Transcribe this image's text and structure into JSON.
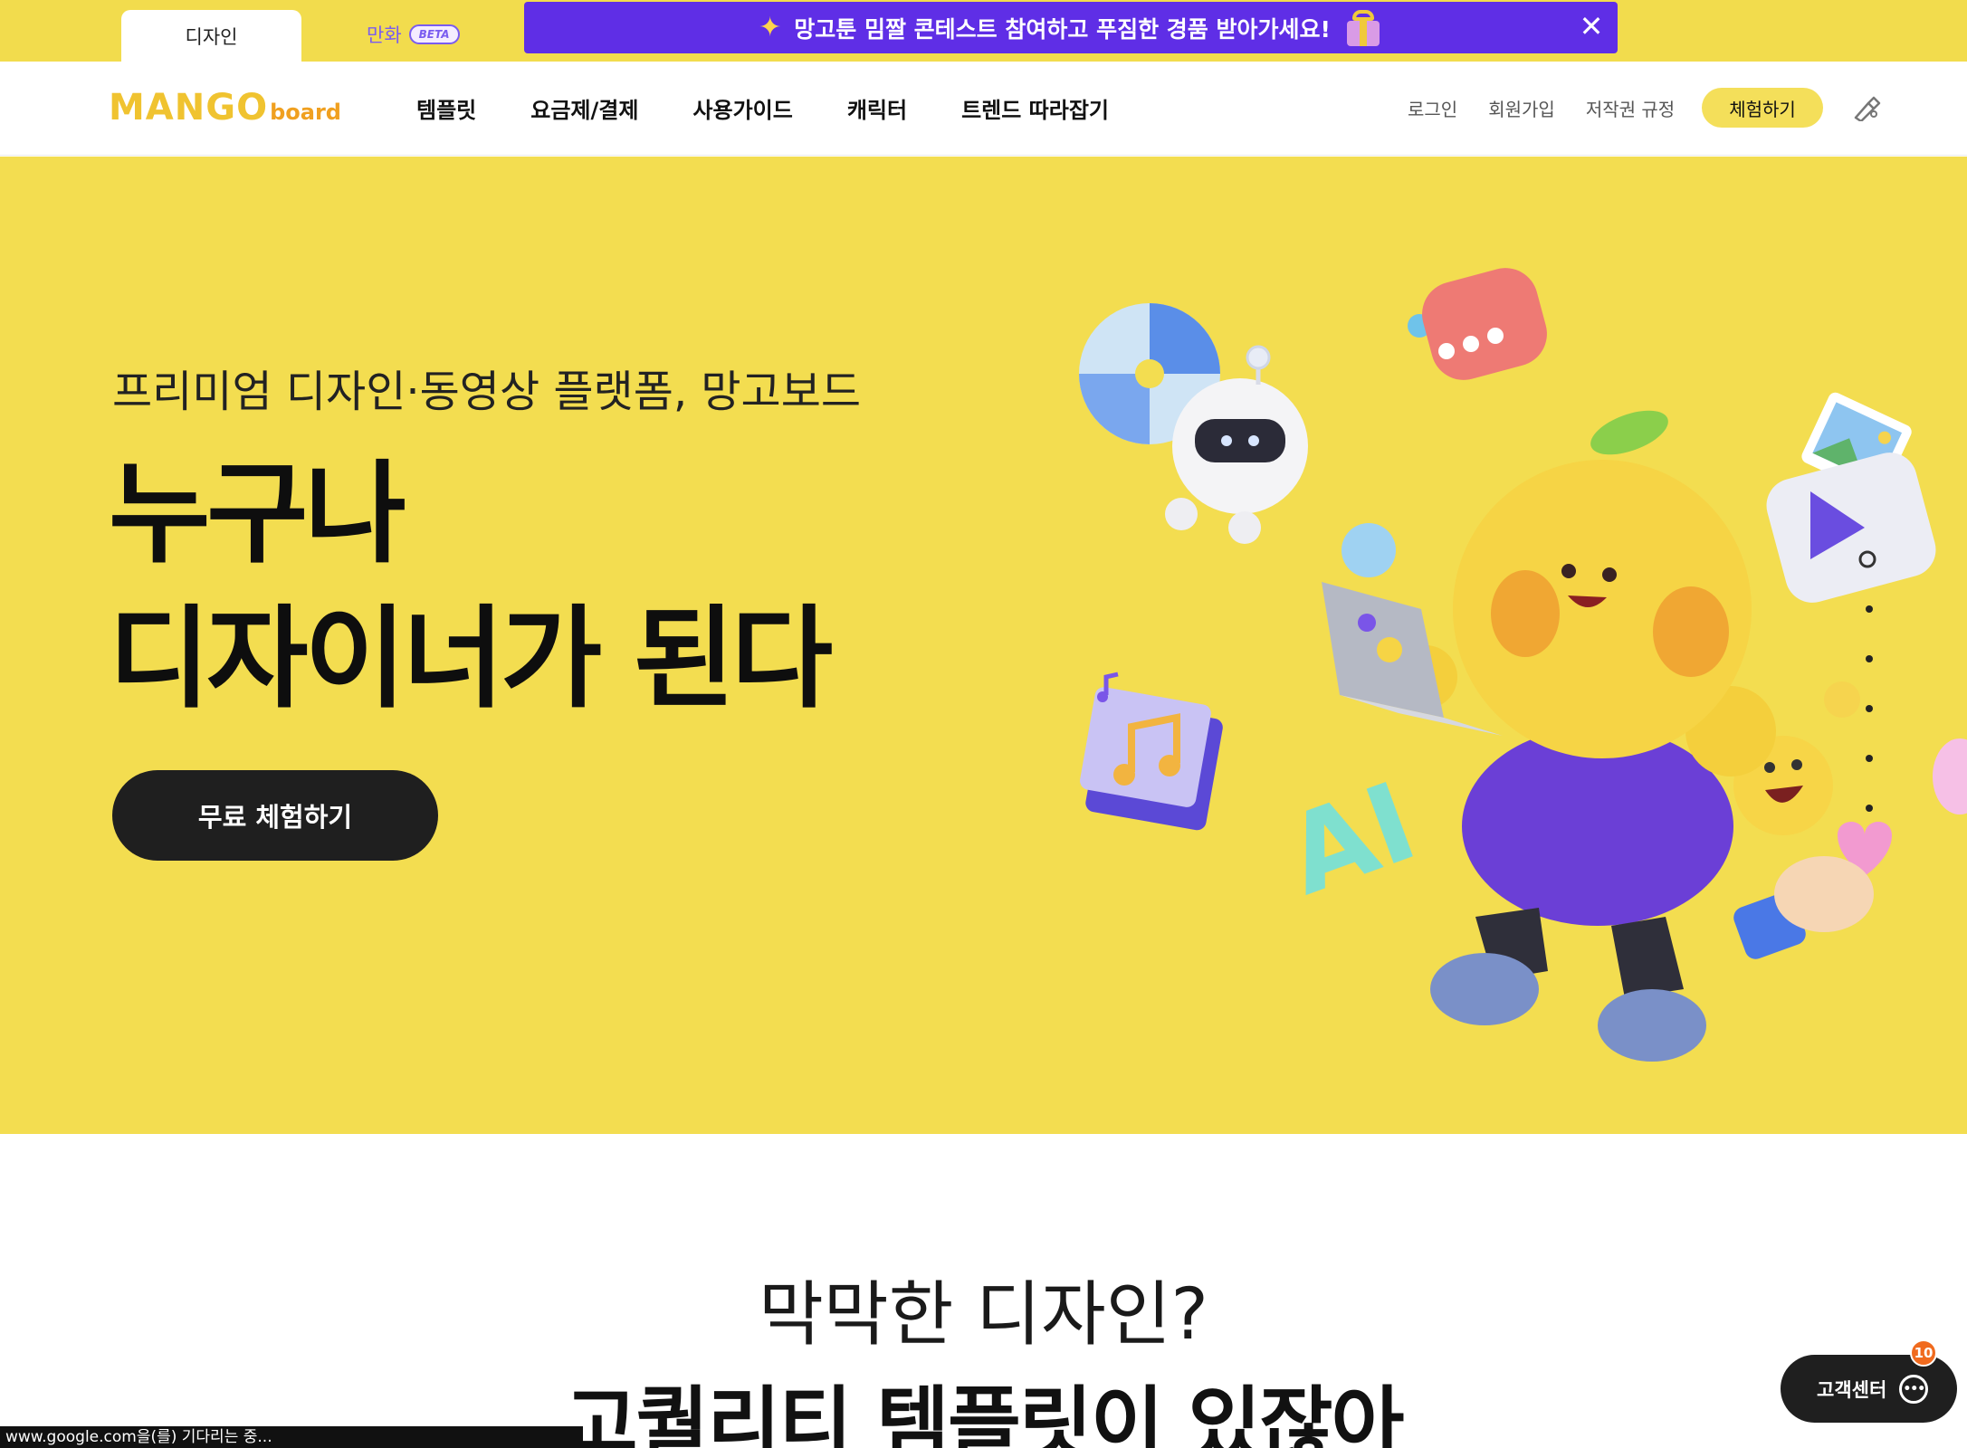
{
  "top_strip": {
    "tab_design": "디자인",
    "tab_comic": "만화",
    "beta_badge": "BETA",
    "promo_text": "망고툰 밈짤 콘테스트 참여하고 푸짐한 경품 받아가세요!"
  },
  "header": {
    "logo_main": "MANGO",
    "logo_sub": "board",
    "nav": [
      "템플릿",
      "요금제/결제",
      "사용가이드",
      "캐릭터",
      "트렌드 따라잡기"
    ],
    "util": [
      "로그인",
      "회원가입",
      "저작권 규정"
    ],
    "trial_button": "체험하기"
  },
  "hero": {
    "subtitle": "프리미엄 디자인·동영상 플랫폼, 망고보드",
    "title_line1": "누구나",
    "title_line2": "디자이너가 된다",
    "cta": "무료 체험하기",
    "illustration_text": "AI"
  },
  "section2": {
    "line1": "막막한 디자인?",
    "line2": "고퀄리티 템플릿이 있잖아"
  },
  "status_bar": "www.google.com을(를) 기다리는 중...",
  "support": {
    "label": "고객센터",
    "badge_count": "10"
  },
  "colors": {
    "brand_yellow": "#f3dd50",
    "promo_purple": "#5f2ee6",
    "dark": "#1f1f1f",
    "badge_orange": "#f06a1e"
  }
}
